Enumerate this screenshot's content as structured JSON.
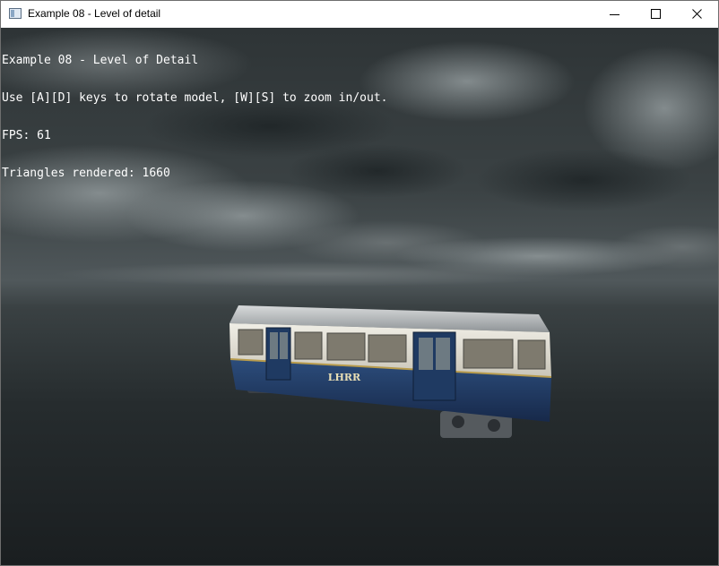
{
  "window": {
    "title": "Example 08 - Level of detail",
    "icon": "app-window-icon",
    "controls": {
      "minimize": "minimize-icon",
      "maximize": "maximize-icon",
      "close": "close-icon"
    }
  },
  "overlay": {
    "line1": "Example 08 - Level of Detail",
    "line2": "Use [A][D] keys to rotate model, [W][S] to zoom in/out.",
    "line3": "FPS: 61",
    "line4": "Triangles rendered: 1660"
  },
  "scene": {
    "model_label": "LHRR",
    "colors": {
      "sky_top": "#2f3638",
      "horizon": "#4a5255",
      "ground": "#1c2123",
      "train_blue": "#23406a",
      "train_cream": "#e6e3d9",
      "text": "#ffffff"
    }
  }
}
